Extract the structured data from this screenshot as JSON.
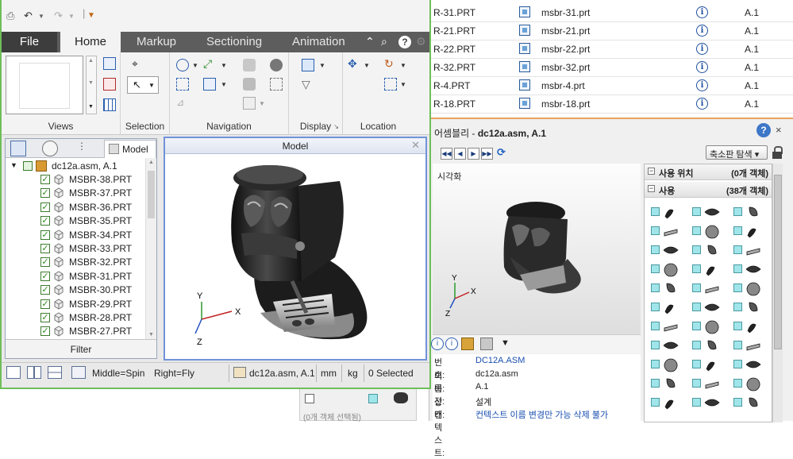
{
  "background_table": {
    "rows": [
      {
        "col1": "R-31.PRT",
        "name": "msbr-31.prt",
        "version": "A.1"
      },
      {
        "col1": "R-21.PRT",
        "name": "msbr-21.prt",
        "version": "A.1"
      },
      {
        "col1": "R-22.PRT",
        "name": "msbr-22.prt",
        "version": "A.1"
      },
      {
        "col1": "R-32.PRT",
        "name": "msbr-32.prt",
        "version": "A.1"
      },
      {
        "col1": "R-4.PRT",
        "name": "msbr-4.prt",
        "version": "A.1"
      },
      {
        "col1": "R-18.PRT",
        "name": "msbr-18.prt",
        "version": "A.1"
      }
    ],
    "info_icon": "info-icon"
  },
  "assembly_panel": {
    "title_prefix": "어셈블리 - ",
    "title_name": "dc12a.asm, A.1",
    "help": "?",
    "close": "×",
    "browse_dropdown": "축소판 탐색 ▾",
    "viz_label": "시각화",
    "where_used": {
      "label": "사용 위치",
      "count": "(0개 객체)"
    },
    "uses": {
      "label": "사용",
      "count": "(38개 객체)"
    },
    "properties": [
      {
        "key": "번호:",
        "value": "DC12A.ASM",
        "link": true
      },
      {
        "key": "이름:",
        "value": "dc12a.asm",
        "link": false
      },
      {
        "key": "버전:",
        "value": "A.1",
        "link": false
      },
      {
        "key": "상태:",
        "value": "설계",
        "link": false
      },
      {
        "key": "컨텍스트:",
        "value": "컨텍스트 이름 변경만 가능 삭제 불가",
        "link": true
      }
    ],
    "mini_strip_text": "(0개 객체 선택됨)",
    "accent": "#e8a25c"
  },
  "creo": {
    "border_color": "#6fbe5a",
    "tabs": [
      "File",
      "Home",
      "Markup",
      "Sectioning",
      "Animation"
    ],
    "groups": [
      "Views",
      "Selection",
      "Navigation",
      "Display",
      "Location"
    ],
    "tree_tab_model": "Model",
    "tree_root": "dc12a.asm, A.1",
    "tree_items": [
      "MSBR-38.PRT",
      "MSBR-37.PRT",
      "MSBR-36.PRT",
      "MSBR-35.PRT",
      "MSBR-34.PRT",
      "MSBR-33.PRT",
      "MSBR-32.PRT",
      "MSBR-31.PRT",
      "MSBR-30.PRT",
      "MSBR-29.PRT",
      "MSBR-28.PRT",
      "MSBR-27.PRT"
    ],
    "filter_label": "Filter",
    "model_view_title": "Model",
    "axes": {
      "x": "X",
      "y": "Y",
      "z": "Z"
    },
    "status": {
      "middle": "Middle=Spin",
      "right": "Right=Fly",
      "model": "dc12a.asm, A.1",
      "unit_length": "mm",
      "unit_mass": "kg",
      "selected": "0 Selected"
    }
  }
}
